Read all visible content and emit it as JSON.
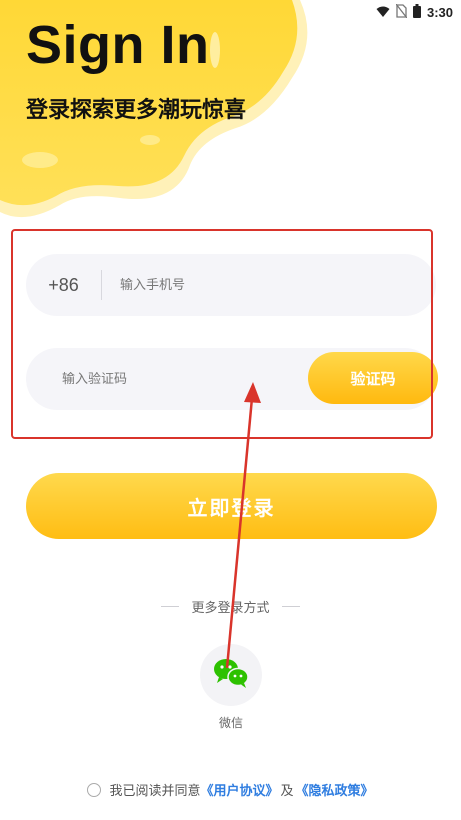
{
  "status_bar": {
    "time": "3:30",
    "icons": [
      "wifi-icon",
      "no-sim-icon",
      "battery-icon"
    ]
  },
  "header": {
    "title": "Sign In",
    "subtitle": "登录探索更多潮玩惊喜"
  },
  "phone_field": {
    "country_code": "+86",
    "placeholder": "输入手机号",
    "value": ""
  },
  "code_field": {
    "placeholder": "输入验证码",
    "value": "",
    "send_code_label": "验证码"
  },
  "login_button": {
    "label": "立即登录"
  },
  "alt_login": {
    "label": "更多登录方式",
    "wechat_label": "微信",
    "wechat_icon": "wechat-icon"
  },
  "agreement": {
    "prefix": "我已阅读并同意",
    "user_agreement": "《用户协议》",
    "conjunction": "及",
    "privacy_policy": "《隐私政策》",
    "checked": false
  },
  "colors": {
    "accent": "#FFC21A",
    "accent_light": "#FFD94D",
    "link": "#2F7DE0",
    "annotation": "#D9342B",
    "field_bg": "#F5F5F9"
  }
}
